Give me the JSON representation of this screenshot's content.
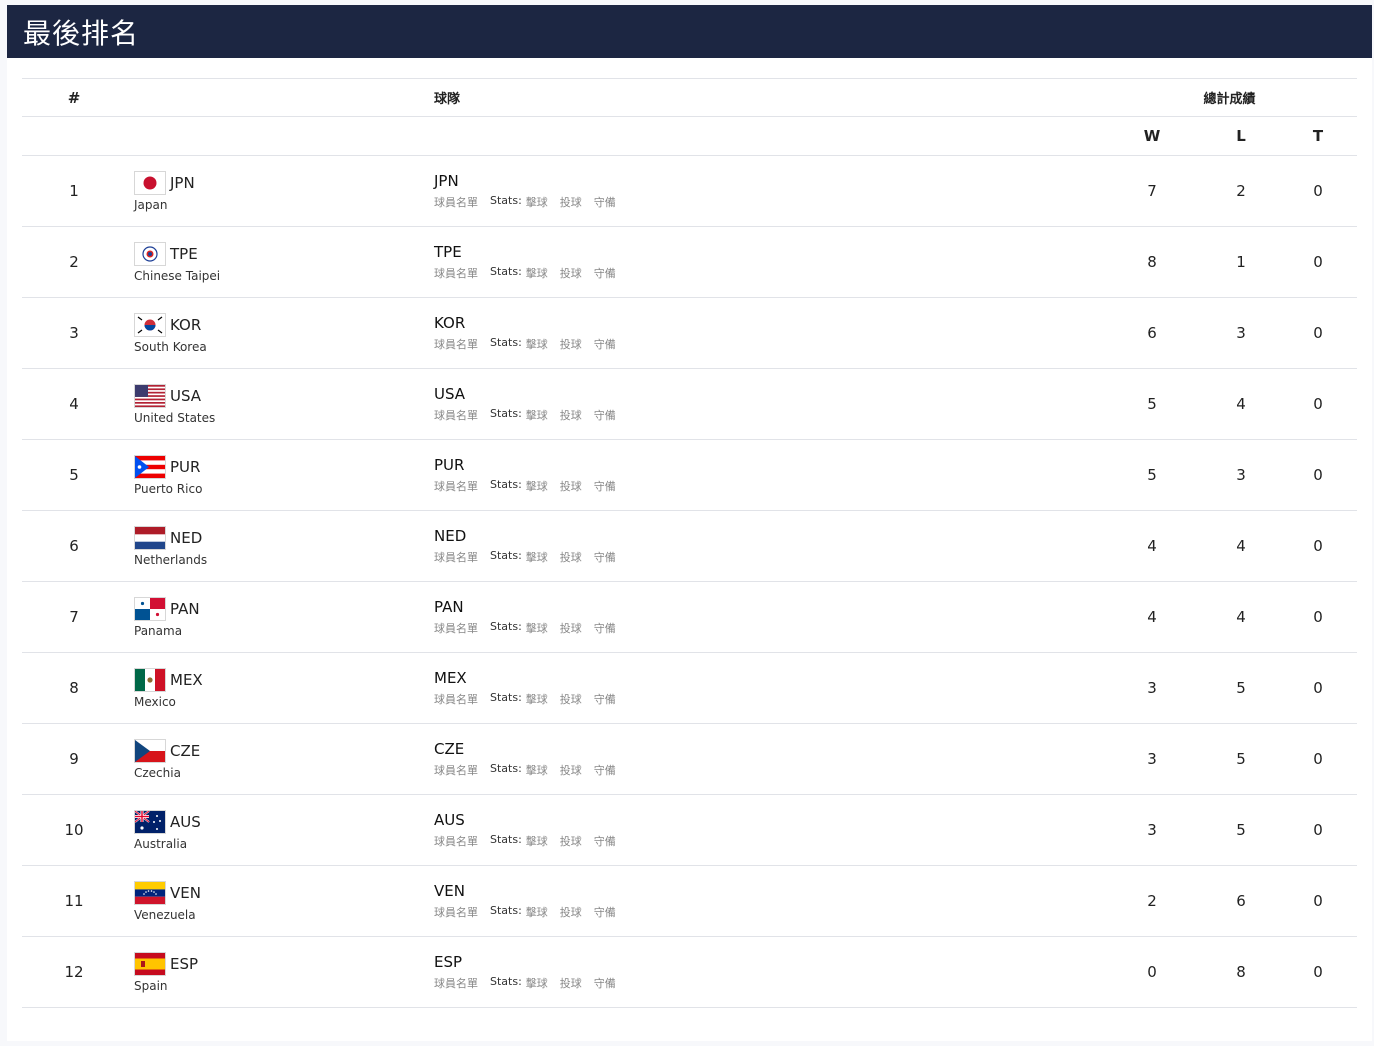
{
  "title": "最後排名",
  "headers": {
    "rank": "#",
    "team": "球隊",
    "record": "總計成績",
    "w": "W",
    "l": "L",
    "t": "T"
  },
  "links": {
    "roster": "球員名單",
    "stats": "Stats:",
    "batting": "擊球",
    "pitching": "投球",
    "fielding": "守備"
  },
  "teams": [
    {
      "rank": "1",
      "code": "JPN",
      "name": "Japan",
      "w": "7",
      "l": "2",
      "t": "0"
    },
    {
      "rank": "2",
      "code": "TPE",
      "name": "Chinese Taipei",
      "w": "8",
      "l": "1",
      "t": "0"
    },
    {
      "rank": "3",
      "code": "KOR",
      "name": "South Korea",
      "w": "6",
      "l": "3",
      "t": "0"
    },
    {
      "rank": "4",
      "code": "USA",
      "name": "United States",
      "w": "5",
      "l": "4",
      "t": "0"
    },
    {
      "rank": "5",
      "code": "PUR",
      "name": "Puerto Rico",
      "w": "5",
      "l": "3",
      "t": "0"
    },
    {
      "rank": "6",
      "code": "NED",
      "name": "Netherlands",
      "w": "4",
      "l": "4",
      "t": "0"
    },
    {
      "rank": "7",
      "code": "PAN",
      "name": "Panama",
      "w": "4",
      "l": "4",
      "t": "0"
    },
    {
      "rank": "8",
      "code": "MEX",
      "name": "Mexico",
      "w": "3",
      "l": "5",
      "t": "0"
    },
    {
      "rank": "9",
      "code": "CZE",
      "name": "Czechia",
      "w": "3",
      "l": "5",
      "t": "0"
    },
    {
      "rank": "10",
      "code": "AUS",
      "name": "Australia",
      "w": "3",
      "l": "5",
      "t": "0"
    },
    {
      "rank": "11",
      "code": "VEN",
      "name": "Venezuela",
      "w": "2",
      "l": "6",
      "t": "0"
    },
    {
      "rank": "12",
      "code": "ESP",
      "name": "Spain",
      "w": "0",
      "l": "8",
      "t": "0"
    }
  ],
  "flag_icons": [
    "japan-flag-icon",
    "chinese-taipei-flag-icon",
    "south-korea-flag-icon",
    "usa-flag-icon",
    "puerto-rico-flag-icon",
    "netherlands-flag-icon",
    "panama-flag-icon",
    "mexico-flag-icon",
    "czechia-flag-icon",
    "australia-flag-icon",
    "venezuela-flag-icon",
    "spain-flag-icon"
  ],
  "colors": {
    "header_bg": "#1c2642",
    "header_text": "#ffffff",
    "divider": "#e1e3e8",
    "link_text": "#888888"
  }
}
